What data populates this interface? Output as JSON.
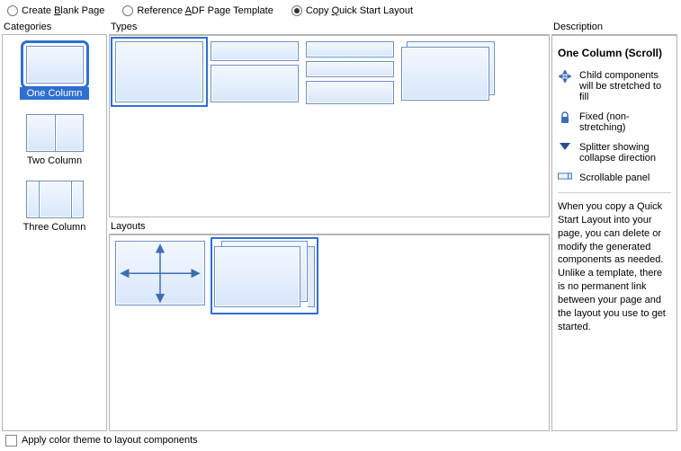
{
  "radios": {
    "blank_pre": "Create ",
    "blank_u": "B",
    "blank_post": "lank Page",
    "ref_pre": "Reference ",
    "ref_u": "A",
    "ref_post": "DF Page Template",
    "copy_pre": "Copy ",
    "copy_u": "Q",
    "copy_post": "uick Start Layout"
  },
  "sections": {
    "categories": "Categories",
    "types": "Types",
    "layouts": "Layouts",
    "description": "Description"
  },
  "categories": {
    "one": "One Column",
    "two": "Two Column",
    "three": "Three Column"
  },
  "description": {
    "title": "One Column (Scroll)",
    "legend_stretch": "Child components will be stretched to fill",
    "legend_fixed": "Fixed (non-stretching)",
    "legend_splitter": "Splitter showing collapse direction",
    "legend_scroll": "Scrollable panel",
    "paragraph": "When you copy a Quick Start Layout into your page, you can delete or modify the generated components as needed. Unlike a template, there is no permanent link between your page and the layout you use to get started."
  },
  "footer": {
    "apply_theme": "Apply color theme to layout components"
  }
}
